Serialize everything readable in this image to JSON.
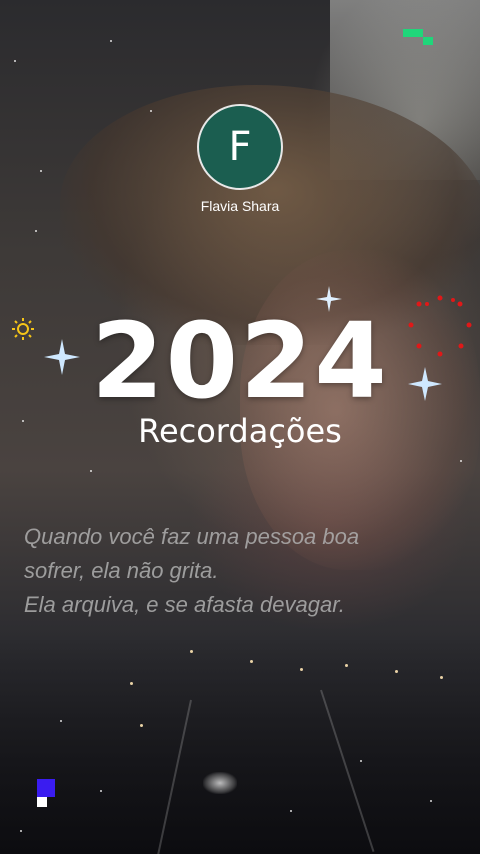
{
  "profile": {
    "avatar_letter": "F",
    "username": "Flavia Shara",
    "avatar_color": "#1b5e50"
  },
  "title": {
    "year": "2024",
    "subtitle": "Recordações"
  },
  "quote": {
    "line1": "Quando você faz uma pessoa boa",
    "line2": "sofrer, ela não grita.",
    "line3": "Ela arquiva, e se afasta devagar."
  },
  "colors": {
    "top_marker": "#1fd67a",
    "bottom_marker": "#3a1cf0"
  }
}
